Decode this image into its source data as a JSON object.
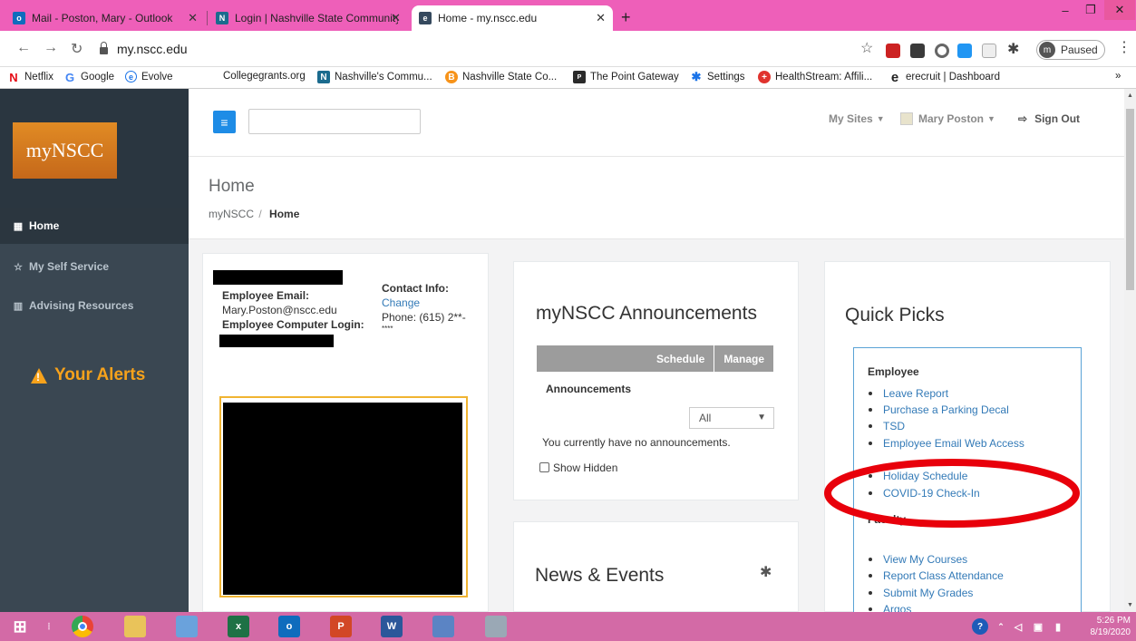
{
  "browser": {
    "tabs": [
      {
        "title": "Mail - Poston, Mary - Outlook",
        "active": false
      },
      {
        "title": "Login | Nashville State Community",
        "active": false
      },
      {
        "title": "Home - my.nscc.edu",
        "active": true
      }
    ],
    "new_tab_glyph": "+",
    "url": "my.nscc.edu",
    "profile_initial": "m",
    "profile_status": "Paused"
  },
  "bookmarks": [
    {
      "label": "Netflix",
      "icon": "netflix-icon"
    },
    {
      "label": "Google",
      "icon": "google-icon"
    },
    {
      "label": "Evolve",
      "icon": "evolve-icon"
    },
    {
      "label": "Collegegrants.org",
      "icon": ""
    },
    {
      "label": "Nashville's Commu...",
      "icon": "nscc-icon"
    },
    {
      "label": "Nashville State Co...",
      "icon": "bitcoin-icon"
    },
    {
      "label": "The Point Gateway",
      "icon": "point-icon"
    },
    {
      "label": "Settings",
      "icon": "gear-icon"
    },
    {
      "label": "HealthStream: Affili...",
      "icon": "healthstream-icon"
    },
    {
      "label": "erecruit | Dashboard",
      "icon": "e-icon"
    }
  ],
  "bookmarks_more": "»",
  "sidebar": {
    "logo": "myNSCC",
    "items": [
      {
        "label": "Home",
        "icon": "grid-icon",
        "active": true
      },
      {
        "label": "My Self Service",
        "icon": "star-icon",
        "active": false
      },
      {
        "label": "Advising Resources",
        "icon": "chart-icon",
        "active": false
      }
    ]
  },
  "topbar": {
    "my_sites": "My Sites",
    "user_name": "Mary Poston",
    "sign_out": "Sign Out"
  },
  "page": {
    "title": "Home",
    "breadcrumb_root": "myNSCC",
    "breadcrumb_sep": "/",
    "breadcrumb_current": "Home"
  },
  "profile_card": {
    "email_label": "Employee Email:",
    "email_value": "Mary.Poston@nscc.edu",
    "login_label": "Employee Computer Login:",
    "contact_label": "Contact Info:",
    "change_link": "Change",
    "phone": "Phone: (615) 2**-",
    "phone_cont": "****",
    "alerts_title": "Your Alerts"
  },
  "announcements": {
    "title": "myNSCC Announcements",
    "schedule_btn": "Schedule",
    "manage_btn": "Manage",
    "section_label": "Announcements",
    "filter_value": "All",
    "empty_message": "You currently have no announcements.",
    "show_hidden": "Show Hidden"
  },
  "news": {
    "title": "News & Events"
  },
  "quick_picks": {
    "title": "Quick Picks",
    "employee_heading": "Employee",
    "employee_links": [
      "Leave Report",
      "Purchase a Parking Decal",
      "TSD",
      "Employee Email Web Access",
      "Holiday Schedule",
      "COVID-19 Check-In"
    ],
    "faculty_heading": "Faculty",
    "faculty_links": [
      "View My Courses",
      "Report Class Attendance",
      "Submit My Grades",
      "Argos"
    ]
  },
  "taskbar": {
    "time": "5:26 PM",
    "date": "8/19/2020"
  },
  "colors": {
    "tab_bar": "#ee5fb9",
    "sidebar": "#3a4752",
    "logo": "#d97a22",
    "link": "#337ab7",
    "alert": "#f7a21b",
    "menu_button": "#1e8ce6",
    "annotation": "#e8000b",
    "taskbar": "#d36aa6"
  }
}
